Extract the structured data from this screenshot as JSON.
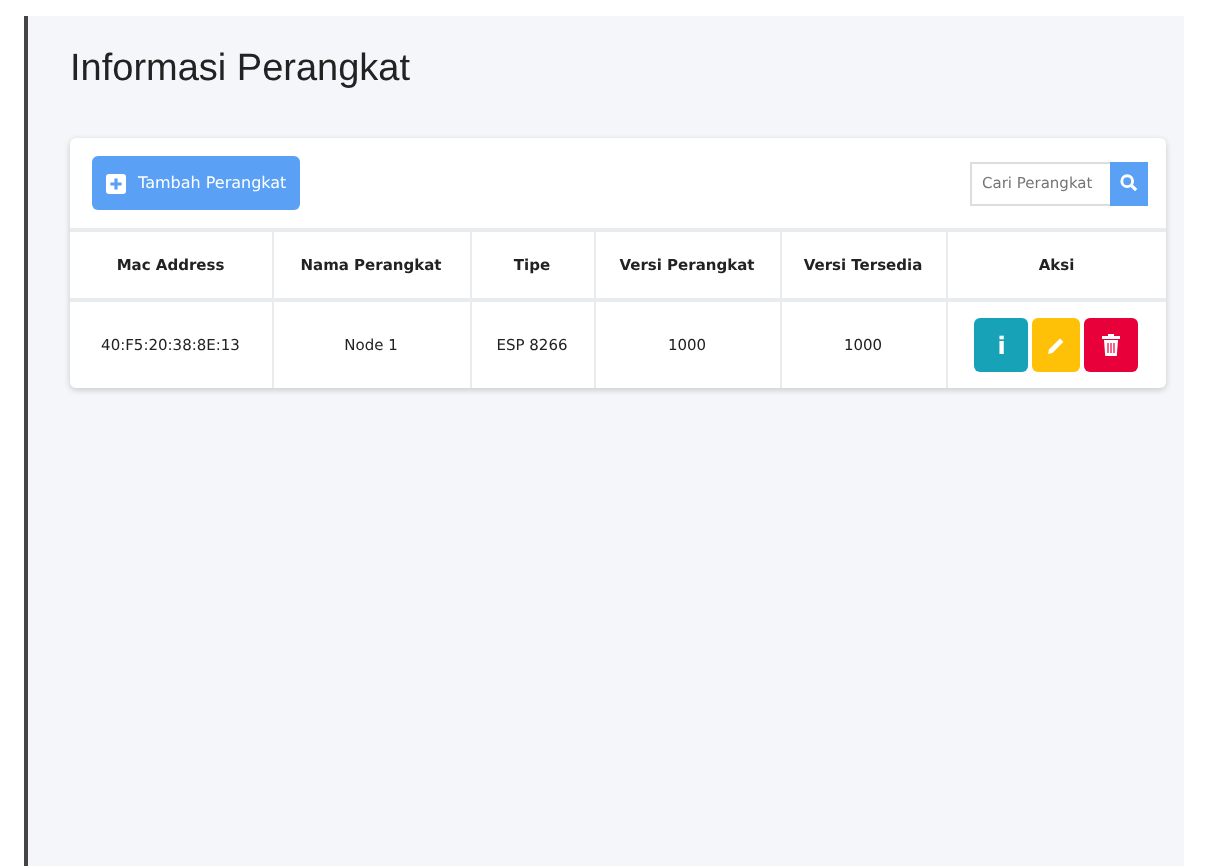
{
  "page": {
    "title": "Informasi Perangkat"
  },
  "toolbar": {
    "add_button": "Tambah Perangkat",
    "search": {
      "placeholder": "Cari Perangkat"
    }
  },
  "table": {
    "columns": [
      "Mac Address",
      "Nama Perangkat",
      "Tipe",
      "Versi Perangkat",
      "Versi Tersedia",
      "Aksi"
    ],
    "rows": [
      {
        "cells": [
          "40:F5:20:38:8E:13",
          "Node 1",
          "ESP 8266",
          "1000",
          "1000"
        ],
        "actions": [
          {
            "kind": "info",
            "label": "i"
          },
          {
            "kind": "edit"
          },
          {
            "kind": "delete"
          }
        ]
      }
    ]
  }
}
